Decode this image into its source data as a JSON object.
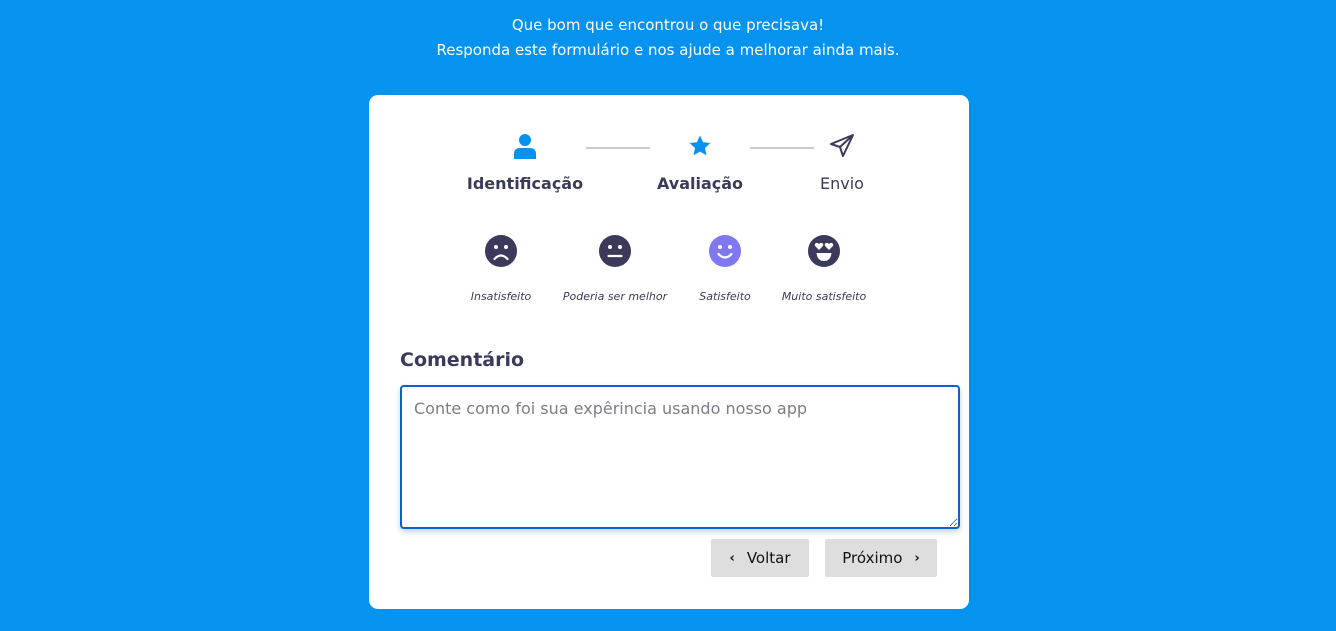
{
  "intro": {
    "line1": "Que bom que encontrou o que precisava!",
    "line2": "Responda este formulário e nos ajude a melhorar ainda mais."
  },
  "steps": [
    {
      "label": "Identificação",
      "icon": "user-icon",
      "state": "done"
    },
    {
      "label": "Avaliação",
      "icon": "star-icon",
      "state": "active"
    },
    {
      "label": "Envio",
      "icon": "send-icon",
      "state": "pending"
    }
  ],
  "ratings": [
    {
      "label": "Insatisfeito",
      "icon": "sad-face-icon",
      "selected": false
    },
    {
      "label": "Poderia ser melhor",
      "icon": "neutral-face-icon",
      "selected": false
    },
    {
      "label": "Satisfeito",
      "icon": "happy-face-icon",
      "selected": true
    },
    {
      "label": "Muito satisfeito",
      "icon": "heart-eyes-face-icon",
      "selected": false
    }
  ],
  "comment": {
    "label": "Comentário",
    "value": "",
    "placeholder": "Conte como foi sua expêrincia usando nosso app"
  },
  "actions": {
    "back_label": "Voltar",
    "next_label": "Próximo"
  },
  "colors": {
    "background": "#0593ef",
    "accent": "#0593ef",
    "selected_face": "#7f78f0",
    "face": "#3b3a5a",
    "button": "#dedede"
  }
}
